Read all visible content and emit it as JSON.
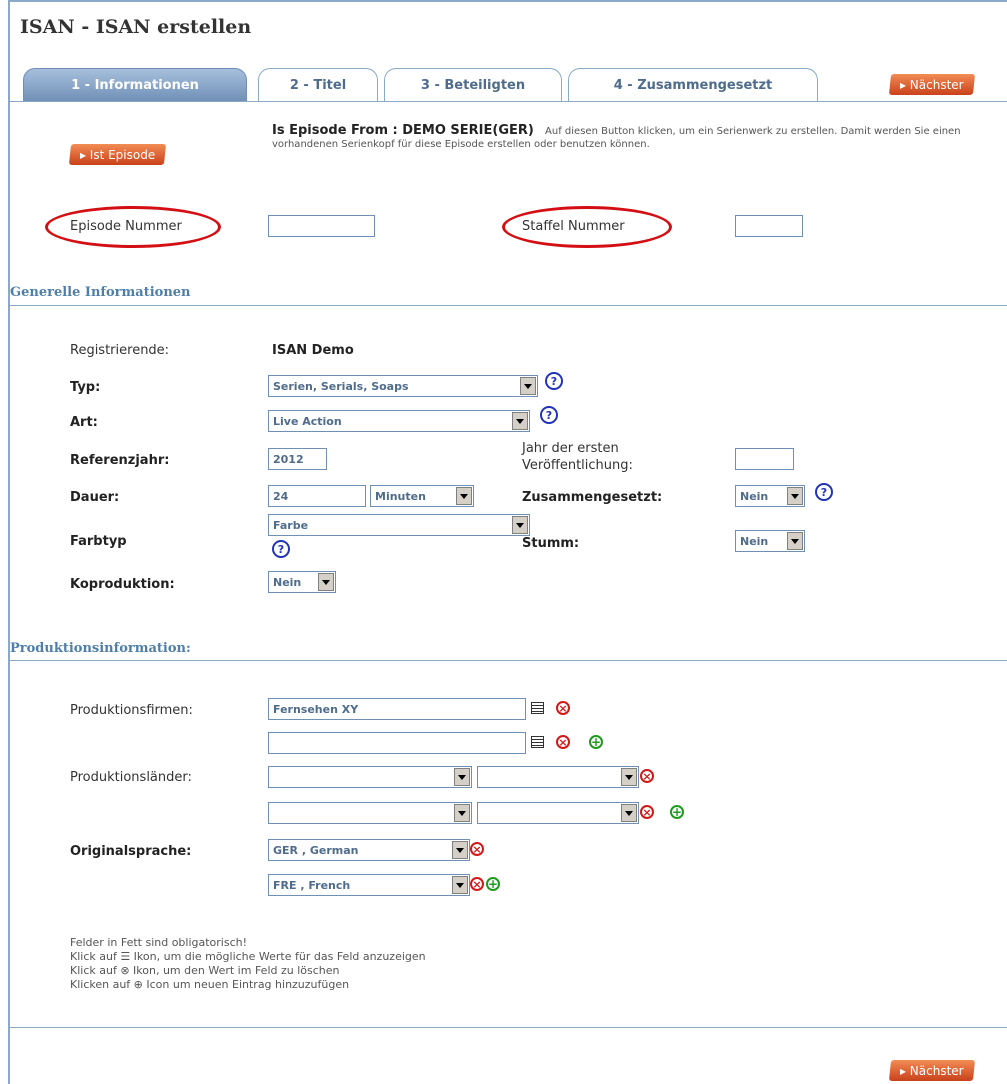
{
  "page_title": "ISAN - ISAN erstellen",
  "tabs": [
    {
      "label": "1 - Informationen",
      "active": true
    },
    {
      "label": "2 - Titel",
      "active": false
    },
    {
      "label": "3 - Beteiligten",
      "active": false
    },
    {
      "label": "4 - Zusammengesetzt",
      "active": false
    }
  ],
  "next_label": "▸ Nächster",
  "episode": {
    "button_label": "▸ Ist Episode",
    "is_episode_from": "Is Episode From :  DEMO SERIE(GER)",
    "help_text": "Auf diesen Button klicken, um ein Serienwerk zu erstellen. Damit werden Sie einen vorhandenen Serienkopf für diese Episode erstellen oder benutzen können.",
    "episode_label": "Episode Nummer",
    "episode_value": "",
    "season_label": "Staffel Nummer",
    "season_value": ""
  },
  "general": {
    "title": "Generelle Informationen",
    "registrant_label": "Registrierende:",
    "registrant_value": "ISAN Demo",
    "type_label": "Typ:",
    "type_value": "Serien, Serials, Soaps",
    "kind_label": "Art:",
    "kind_value": "Live Action",
    "ref_year_label": "Referenzjahr:",
    "ref_year_value": "2012",
    "first_pub_label": "Jahr der ersten Veröffentlichung:",
    "first_pub_value": "",
    "duration_label": "Dauer:",
    "duration_value": "24",
    "duration_unit": "Minuten",
    "composite_label": "Zusammengesetzt:",
    "composite_value": "Nein",
    "color_label": "Farbtyp",
    "color_value": "Farbe",
    "silent_label": "Stumm:",
    "silent_value": "Nein",
    "coprod_label": "Koproduktion:",
    "coprod_value": "Nein"
  },
  "production": {
    "title": "Produktionsinformation:",
    "companies_label": "Produktionsfirmen:",
    "company_1": "Fernsehen XY",
    "company_2": "",
    "countries_label": "Produktionsländer:",
    "language_label": "Originalsprache:",
    "language_1": "GER , German",
    "language_2": "FRE , French"
  },
  "notes": {
    "line1": "Felder in Fett sind obligatorisch!",
    "line2": "Klick auf ☰ Ikon, um die mögliche Werte für das Feld anzuzeigen",
    "line3": "Klick auf ⊗ Ikon, um den Wert im Feld zu löschen",
    "line4": "Klicken auf ⊕ Icon um neuen Eintrag hinzuzufügen"
  },
  "icons": {
    "help": "question-icon",
    "delete": "delete-icon",
    "add": "add-icon",
    "list": "list-icon"
  },
  "colors": {
    "accent_blue": "#4f7fa8",
    "orange": "#e0642c",
    "delete_red": "#d41818",
    "add_green": "#1f9a1f",
    "highlight_red": "#d40f14"
  }
}
